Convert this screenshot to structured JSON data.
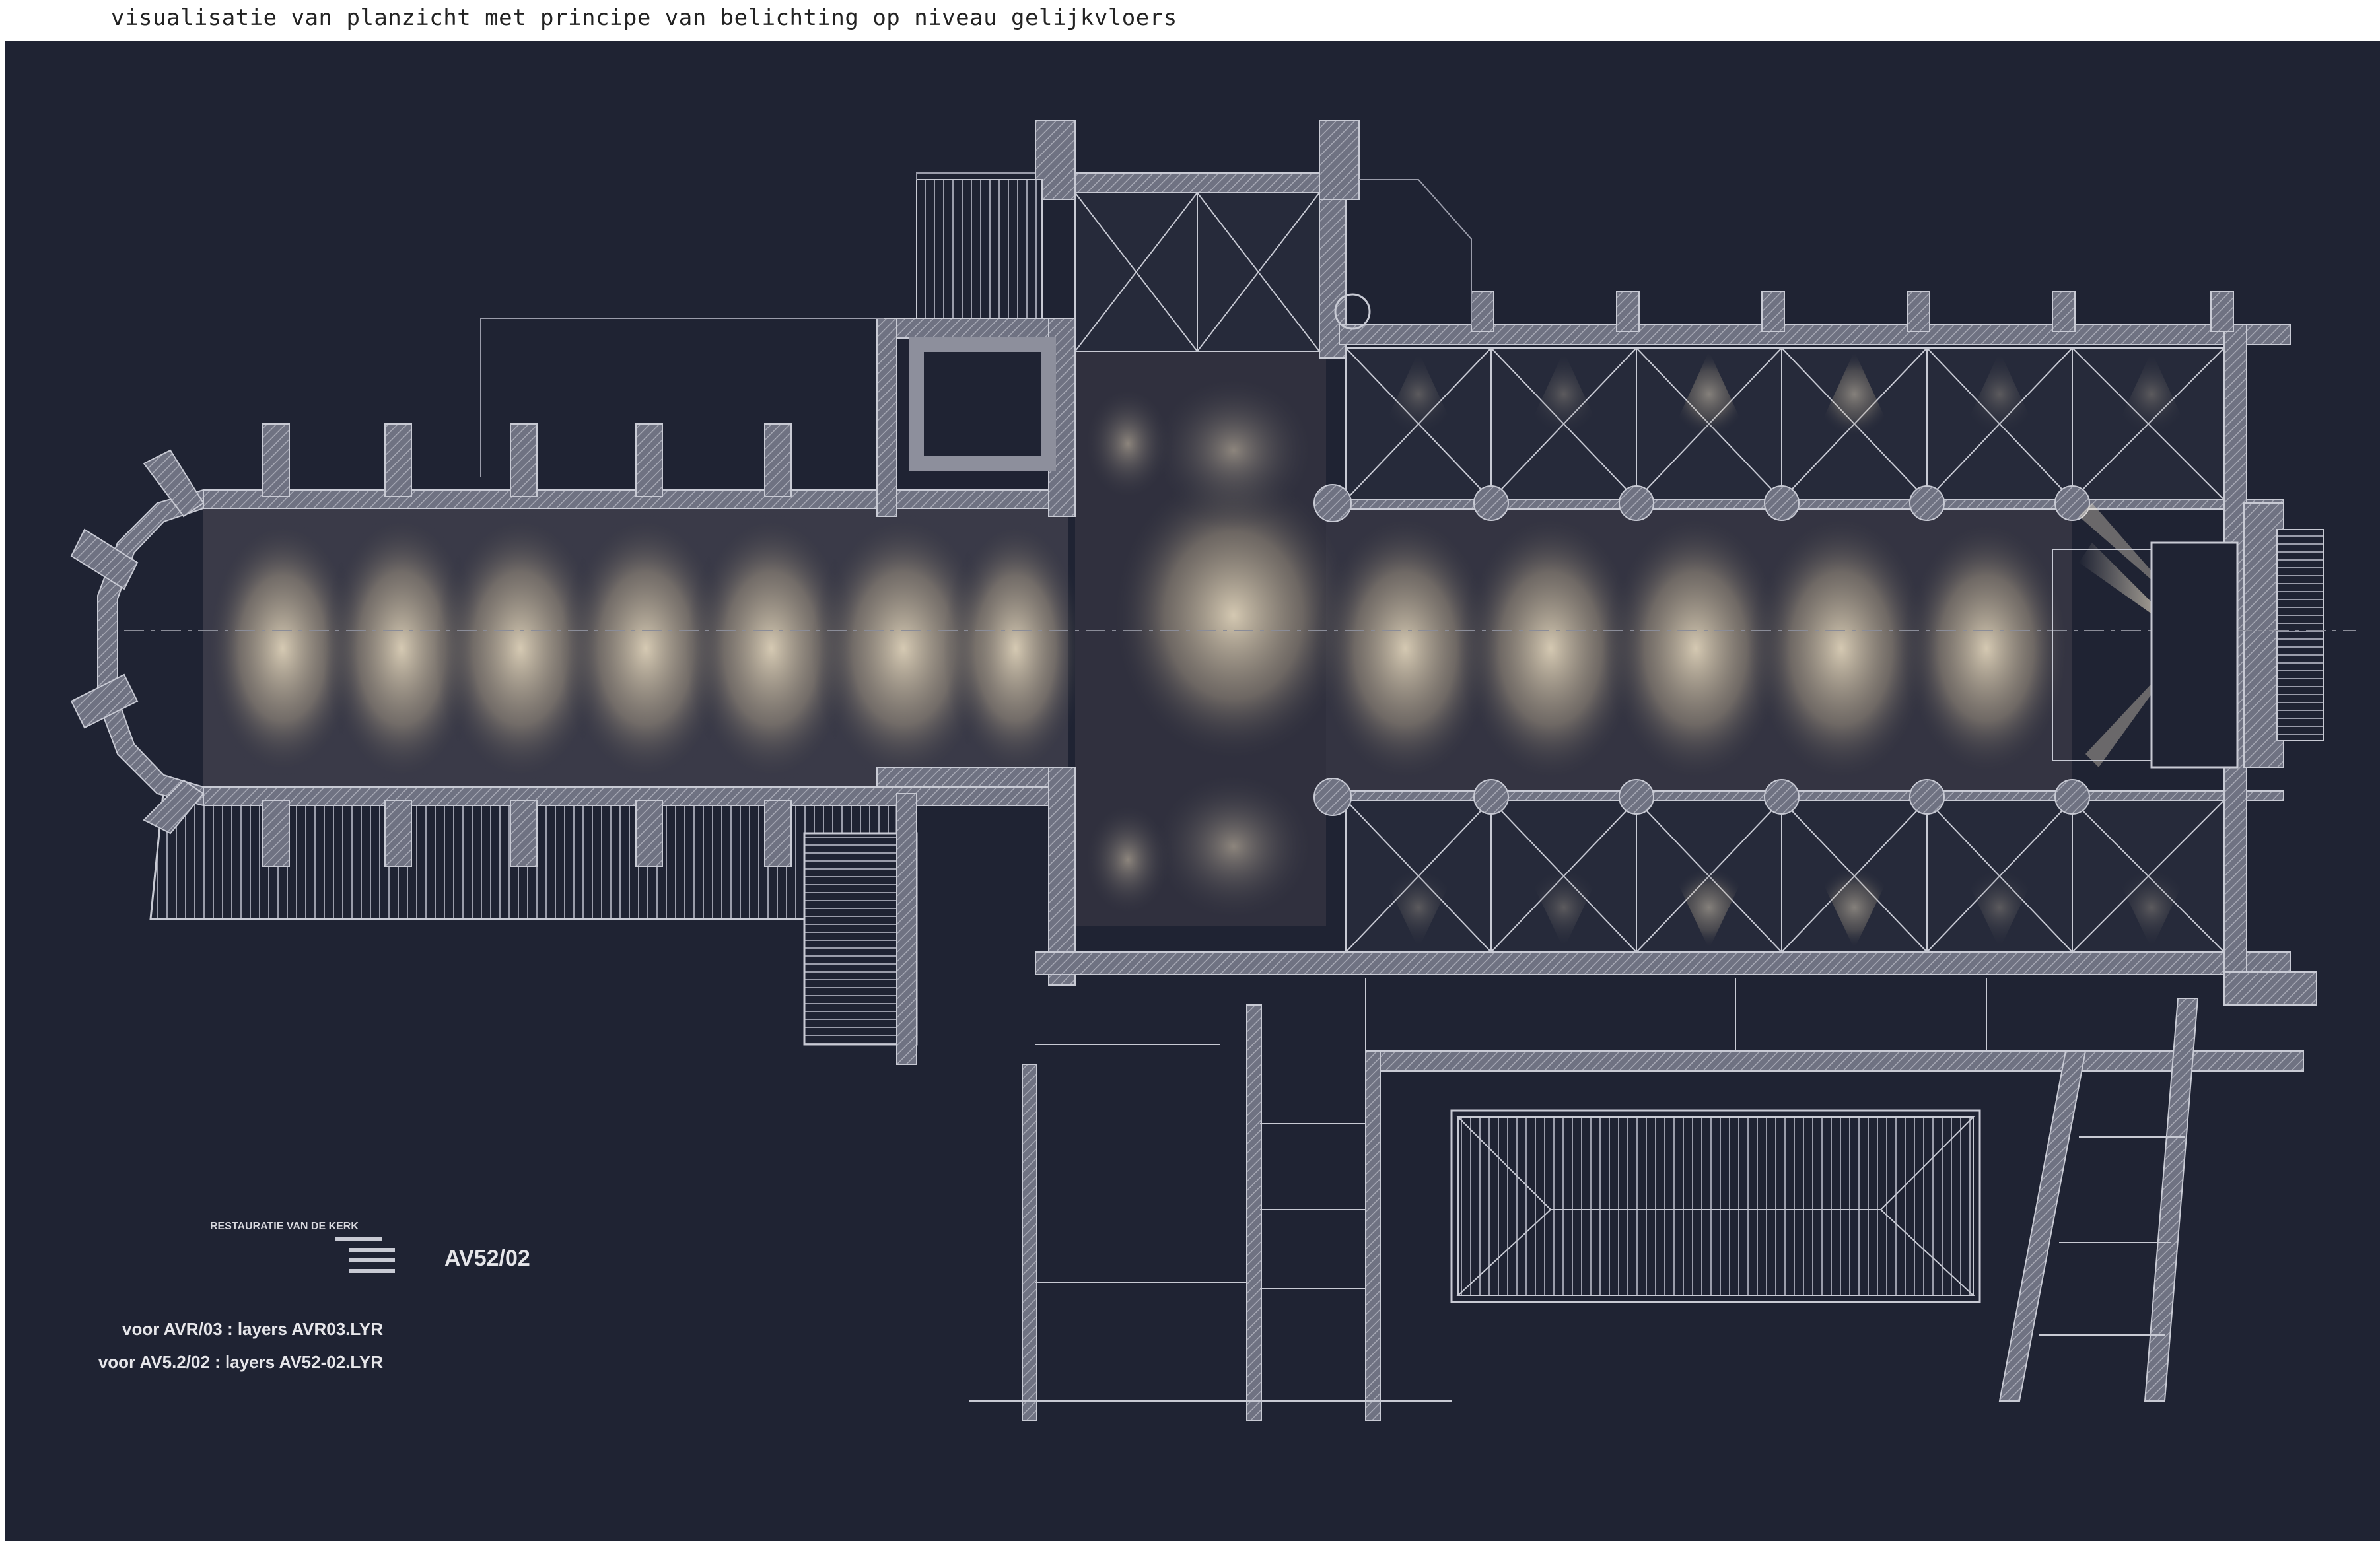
{
  "header": {
    "title": "visualisatie van planzicht met principe van belichting op niveau gelijkvloers"
  },
  "drawing": {
    "code": "AV52/02",
    "legend_lines": [
      "voor AVR/03 : layers AVR03.LYR",
      "voor AV5.2/02 : layers AV52-02.LYR"
    ],
    "colors": {
      "background": "#1f2333",
      "walls": "#8d8f9c",
      "lines": "#c8cad4",
      "light": "#efe2c8"
    }
  }
}
